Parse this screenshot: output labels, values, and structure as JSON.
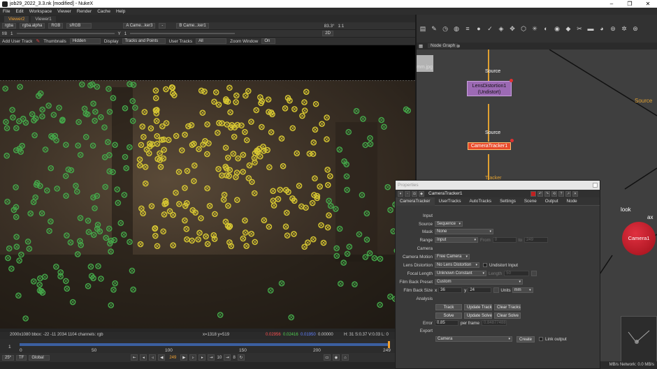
{
  "window": {
    "title": "job29_2022_3.3.nk [modified] - NukeX",
    "controls": [
      "–",
      "❐",
      "✕"
    ]
  },
  "menu": [
    "File",
    "Edit",
    "Workspace",
    "Viewer",
    "Render",
    "Cache",
    "Help"
  ],
  "viewer": {
    "tabs": [
      "Viewer2",
      "Viewer1"
    ],
    "toolbar1": {
      "channels": "rgba",
      "alpha": "rgba.alpha",
      "rgb": "RGB",
      "colorspace": "sRGB",
      "a_input": "A  Came...ker3",
      "dash": "-",
      "b_input": "B  Came...ker1",
      "zoom": "83.3°",
      "ratio": "1:1"
    },
    "toolbar2": {
      "fstop": "f/8",
      "one": "1",
      "y": "Y",
      "yval": "1",
      "view": "2D"
    },
    "tracker_bar": {
      "add_track": "Add User Track",
      "thumbnails_label": "Thumbnails",
      "thumbnails_value": "Hidden",
      "display_label": "Display",
      "display_value": "Tracks and Points",
      "user_tracks_label": "User Tracks",
      "user_tracks_value": "All",
      "zoom_window_label": "Zoom Window",
      "zoom_window_value": "On"
    },
    "info": {
      "format": "2000x1080  bbox: -22 -11 2034 1104 channels: rgb",
      "coords": "x=1318 y=519",
      "r": "0.02956",
      "g": "0.02416",
      "b": "0.01950",
      "a": "0.00000",
      "hsv": "H: 31 S:0.37 V:0.03  L: 0"
    },
    "timeline": {
      "ticks": [
        "0",
        "50",
        "100",
        "150",
        "200",
        "249"
      ],
      "start": "1",
      "end": "249"
    },
    "playbar": {
      "fps": "25*",
      "tf": "TF",
      "global": "Global",
      "frame": "249",
      "step": "10",
      "inc": "8"
    }
  },
  "nodegraph": {
    "tab": "Node Graph",
    "thumb_label": "mm.jpg",
    "nodes": [
      {
        "label": "LensDistortion1",
        "sub": "(Undistort)"
      },
      {
        "label": "CameraTracker1"
      },
      {
        "label": "Camera1"
      }
    ],
    "labels": {
      "source1": "Source",
      "source2": "Source",
      "source3": "Source",
      "tracker": "Tracker",
      "look": "look",
      "axis": "ax"
    },
    "status": "MB/s Network: 0.0 MB/s"
  },
  "properties": {
    "title": "Properties",
    "node_name": "CameraTracker1",
    "tabs": [
      "CameraTracker",
      "UserTracks",
      "AutoTracks",
      "Settings",
      "Scene",
      "Output",
      "Node"
    ],
    "sections": {
      "input": "Input",
      "camera": "Camera",
      "analysis": "Analysis",
      "export": "Export"
    },
    "fields": {
      "source": {
        "label": "Source",
        "value": "Sequence"
      },
      "mask": {
        "label": "Mask",
        "value": "None"
      },
      "range": {
        "label": "Range",
        "value": "Input",
        "from_label": "From",
        "from": "0",
        "to_label": "to",
        "to": "249"
      },
      "camera_motion": {
        "label": "Camera Motion",
        "value": "Free Camera"
      },
      "lens_distortion": {
        "label": "Lens Distortion",
        "value": "No Lens Distortion",
        "undistort": "Undistort Input"
      },
      "focal_length": {
        "label": "Focal Length",
        "value": "Unknown Constant",
        "length_label": "Length",
        "length": "50"
      },
      "film_back_preset": {
        "label": "Film Back Preset",
        "value": "Custom"
      },
      "film_back_size": {
        "label": "Film Back Size",
        "x_label": "x",
        "x": "36",
        "y_label": "y",
        "y": "24",
        "units_label": "Units",
        "units": "mm"
      },
      "error": {
        "label": "Error",
        "value": "0.85",
        "per_frame_label": "per frame",
        "per_frame": "0.84877488"
      },
      "export": {
        "value": "Camera",
        "create": "Create",
        "link": "Link output"
      }
    },
    "buttons": {
      "track": "Track",
      "update_track": "Update Track",
      "clear_tracks": "Clear Tracks",
      "solve": "Solve",
      "update_solve": "Update Solve",
      "clear_solve": "Clear Solve"
    }
  },
  "colors": {
    "accent_orange": "#f0a030",
    "track_yellow": "#d8c832",
    "track_green": "#44a84a",
    "camera_red": "#c0141e",
    "node_purple": "#9c6ab4",
    "tracker_node": "#e84a2a"
  }
}
